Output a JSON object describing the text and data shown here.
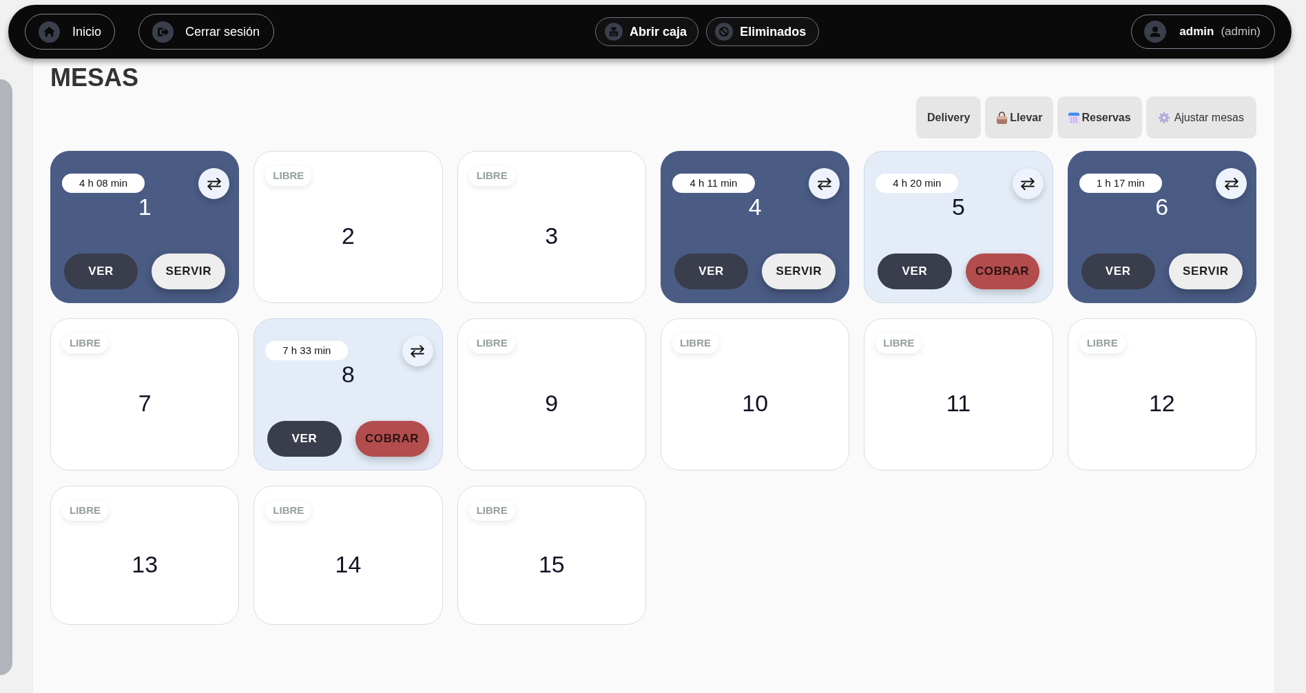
{
  "top_bar": {
    "home_button": {
      "label": "Inicio"
    },
    "logout_button": {
      "label": "Cerrar sesión"
    },
    "open_register_button": {
      "label": "Abrir caja"
    },
    "deleted_button": {
      "label": "Eliminados"
    },
    "user": {
      "name": "admin",
      "role": "(admin)"
    }
  },
  "page_title": "MESAS",
  "toolbar": {
    "delivery_button": {
      "label": "Delivery"
    },
    "takeaway_button": {
      "label": "Llevar"
    },
    "reservations_button": {
      "label": "Reservas"
    },
    "adjust_tables_button": {
      "label": "Ajustar mesas"
    }
  },
  "tables": [
    {
      "number": "1",
      "kind": "serving",
      "timer": "4 h 08 min",
      "buttons": [
        {
          "label": "VER",
          "kind": "view"
        },
        {
          "label": "SERVIR",
          "kind": "serve"
        }
      ]
    },
    {
      "number": "2",
      "kind": "free",
      "badge": "LIBRE"
    },
    {
      "number": "3",
      "kind": "free",
      "badge": "LIBRE"
    },
    {
      "number": "4",
      "kind": "serving",
      "timer": "4 h 11 min",
      "buttons": [
        {
          "label": "VER",
          "kind": "view"
        },
        {
          "label": "SERVIR",
          "kind": "serve"
        }
      ]
    },
    {
      "number": "5",
      "kind": "billing",
      "timer": "4 h 20 min",
      "buttons": [
        {
          "label": "VER",
          "kind": "view"
        },
        {
          "label": "COBRAR",
          "kind": "charge"
        }
      ]
    },
    {
      "number": "6",
      "kind": "serving",
      "timer": "1 h 17 min",
      "buttons": [
        {
          "label": "VER",
          "kind": "view"
        },
        {
          "label": "SERVIR",
          "kind": "serve"
        }
      ]
    },
    {
      "number": "7",
      "kind": "free",
      "badge": "LIBRE"
    },
    {
      "number": "8",
      "kind": "billing",
      "timer": "7 h 33 min",
      "buttons": [
        {
          "label": "VER",
          "kind": "view"
        },
        {
          "label": "COBRAR",
          "kind": "charge"
        }
      ]
    },
    {
      "number": "9",
      "kind": "free",
      "badge": "LIBRE"
    },
    {
      "number": "10",
      "kind": "free",
      "badge": "LIBRE"
    },
    {
      "number": "11",
      "kind": "free",
      "badge": "LIBRE"
    },
    {
      "number": "12",
      "kind": "free",
      "badge": "LIBRE"
    },
    {
      "number": "13",
      "kind": "free",
      "badge": "LIBRE"
    },
    {
      "number": "14",
      "kind": "free",
      "badge": "LIBRE"
    },
    {
      "number": "15",
      "kind": "free",
      "badge": "LIBRE"
    }
  ]
}
